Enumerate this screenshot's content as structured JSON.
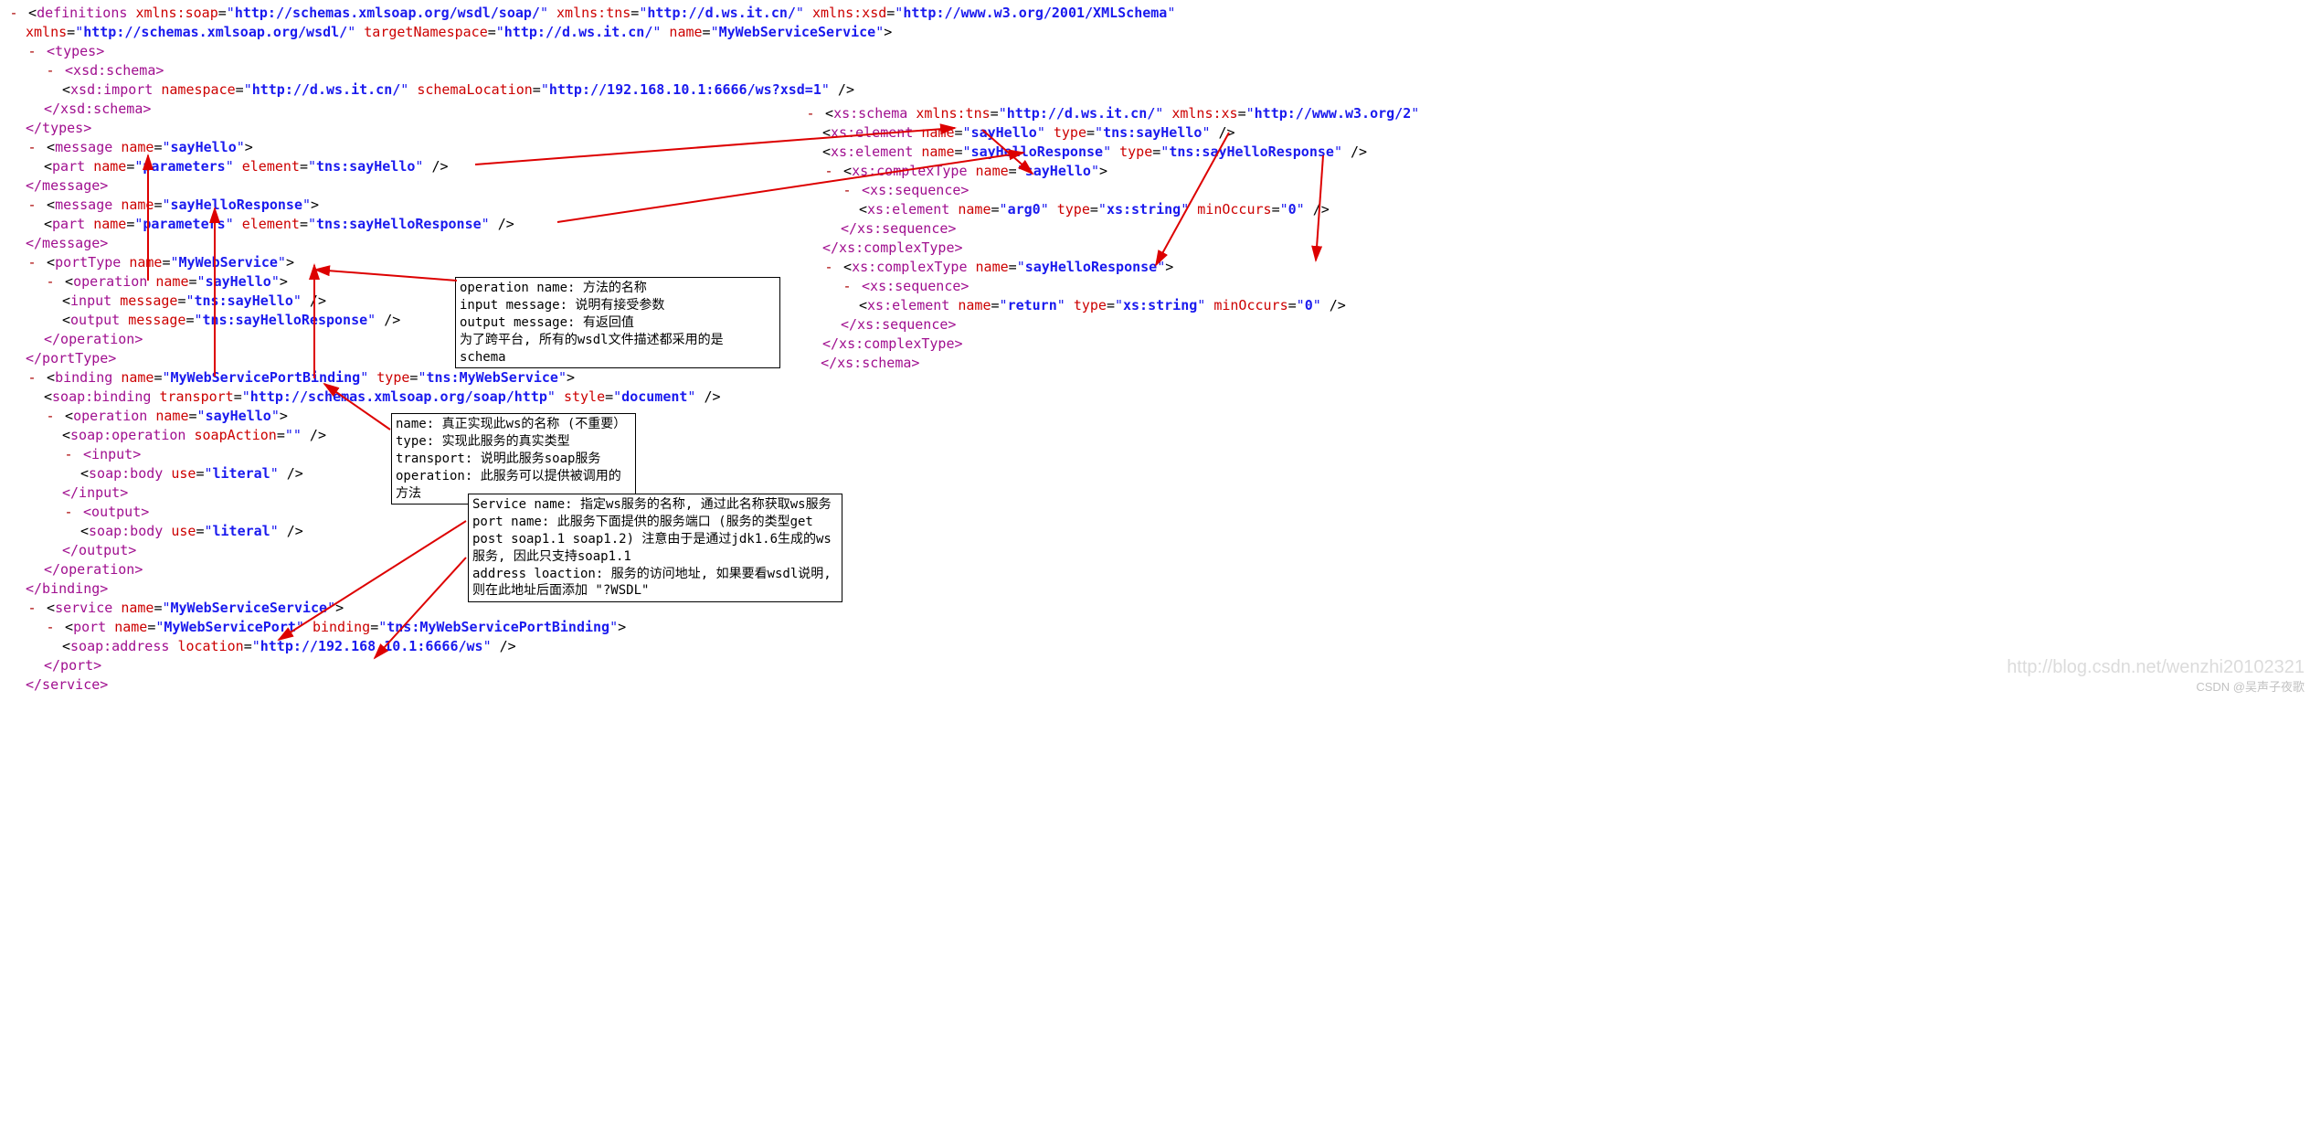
{
  "left": {
    "definitions": {
      "xmlns_soap_name": "xmlns:soap",
      "xmlns_soap_val": "http://schemas.xmlsoap.org/wsdl/soap/",
      "xmlns_tns_name": "xmlns:tns",
      "xmlns_tns_val": "http://d.ws.it.cn/",
      "xmlns_xsd_name": "xmlns:xsd",
      "xmlns_xsd_val": "http://www.w3.org/2001/XMLSchema",
      "xmlns_name": "xmlns",
      "xmlns_val": "http://schemas.xmlsoap.org/wsdl/",
      "targetns_name": "targetNamespace",
      "targetns_val": "http://d.ws.it.cn/",
      "name_name": "name",
      "name_val": "MyWebServiceService"
    },
    "types_open": "<types>",
    "types_close": "</types>",
    "xsd_schema_open": "<xsd:schema>",
    "xsd_schema_close": "</xsd:schema>",
    "xsd_import": {
      "tag": "xsd:import",
      "ns_name": "namespace",
      "ns_val": "http://d.ws.it.cn/",
      "loc_name": "schemaLocation",
      "loc_val": "http://192.168.10.1:6666/ws?xsd=1"
    },
    "msg1": {
      "tag": "message",
      "name": "sayHello",
      "part_tag": "part",
      "part_name": "parameters",
      "elem_name": "element",
      "elem_val": "tns:sayHello",
      "close": "</message>"
    },
    "msg2": {
      "tag": "message",
      "name": "sayHelloResponse",
      "part_tag": "part",
      "part_name": "parameters",
      "elem_name": "element",
      "elem_val": "tns:sayHelloResponse",
      "close": "</message>"
    },
    "porttype": {
      "tag": "portType",
      "name": "MyWebService",
      "close": "</portType>"
    },
    "op1": {
      "tag": "operation",
      "name": "sayHello",
      "input_tag": "input",
      "input_attr": "message",
      "input_val": "tns:sayHello",
      "output_tag": "output",
      "output_attr": "message",
      "output_val": "tns:sayHelloResponse",
      "close": "</operation>"
    },
    "binding": {
      "tag": "binding",
      "name": "MyWebServicePortBinding",
      "type_name": "type",
      "type_val": "tns:MyWebService",
      "close": "</binding>"
    },
    "soap_binding": {
      "tag": "soap:binding",
      "transport_name": "transport",
      "transport_val": "http://schemas.xmlsoap.org/soap/http",
      "style_name": "style",
      "style_val": "document"
    },
    "op2": {
      "tag": "operation",
      "name": "sayHello",
      "close": "</operation>"
    },
    "soap_operation": {
      "tag": "soap:operation",
      "action_name": "soapAction",
      "action_val": ""
    },
    "input_open": "<input>",
    "input_close": "</input>",
    "output_open": "<output>",
    "output_close": "</output>",
    "soap_body": {
      "tag": "soap:body",
      "use_name": "use",
      "use_val": "literal"
    },
    "service": {
      "tag": "service",
      "name": "MyWebServiceService",
      "close": "</service>"
    },
    "port": {
      "tag": "port",
      "name": "MyWebServicePort",
      "bind_name": "binding",
      "bind_val": "tns:MyWebServicePortBinding",
      "close": "</port>"
    },
    "soap_addr": {
      "tag": "soap:address",
      "loc_name": "location",
      "loc_val": "http://192.168.10.1:6666/ws"
    }
  },
  "right": {
    "schema": {
      "tag": "xs:schema",
      "tns_name": "xmlns:tns",
      "tns_val": "http://d.ws.it.cn/",
      "xs_name": "xmlns:xs",
      "xs_val": "http://www.w3.org/2",
      "close": "</xs:schema>"
    },
    "el1": {
      "tag": "xs:element",
      "name": "sayHello",
      "type_name": "type",
      "type_val": "tns:sayHello"
    },
    "el2": {
      "tag": "xs:element",
      "name": "sayHelloResponse",
      "type_name": "type",
      "type_val": "tns:sayHelloResponse"
    },
    "ct1": {
      "tag": "xs:complexType",
      "name": "sayHello",
      "close": "</xs:complexType>"
    },
    "ct2": {
      "tag": "xs:complexType",
      "name": "sayHelloResponse",
      "close": "</xs:complexType>"
    },
    "seq_open": "<xs:sequence>",
    "seq_close": "</xs:sequence>",
    "arg0": {
      "tag": "xs:element",
      "name": "arg0",
      "type_name": "type",
      "type_val": "xs:string",
      "min_name": "minOccurs",
      "min_val": "0"
    },
    "ret": {
      "tag": "xs:element",
      "name": "return",
      "type_name": "type",
      "type_val": "xs:string",
      "min_name": "minOccurs",
      "min_val": "0"
    }
  },
  "note1": {
    "l1": "operation name: 方法的名称",
    "l2": "input message: 说明有接受参数",
    "l3": "output message: 有返回值",
    "l4": "为了跨平台, 所有的wsdl文件描述都采用的是  schema"
  },
  "note2": {
    "l1": "name: 真正实现此ws的名称 (不重要）",
    "l2": "type: 实现此服务的真实类型",
    "l3": "transport:  说明此服务soap服务",
    "l4": "operation:   此服务可以提供被调用的方法"
  },
  "note3": {
    "l1": "Service name: 指定ws服务的名称, 通过此名称获取ws服务",
    "l2": "port  name: 此服务下面提供的服务端口 (服务的类型get post soap1.1 soap1.2)  注意由于是通过jdk1.6生成的ws服务, 因此只支持soap1.1",
    "l3": "address loaction: 服务的访问地址,   如果要看wsdl说明, 则在此地址后面添加  \"?WSDL\""
  },
  "watermark1": "http://blog.csdn.net/wenzhi20102321",
  "watermark2": "CSDN @吴声子夜歌"
}
